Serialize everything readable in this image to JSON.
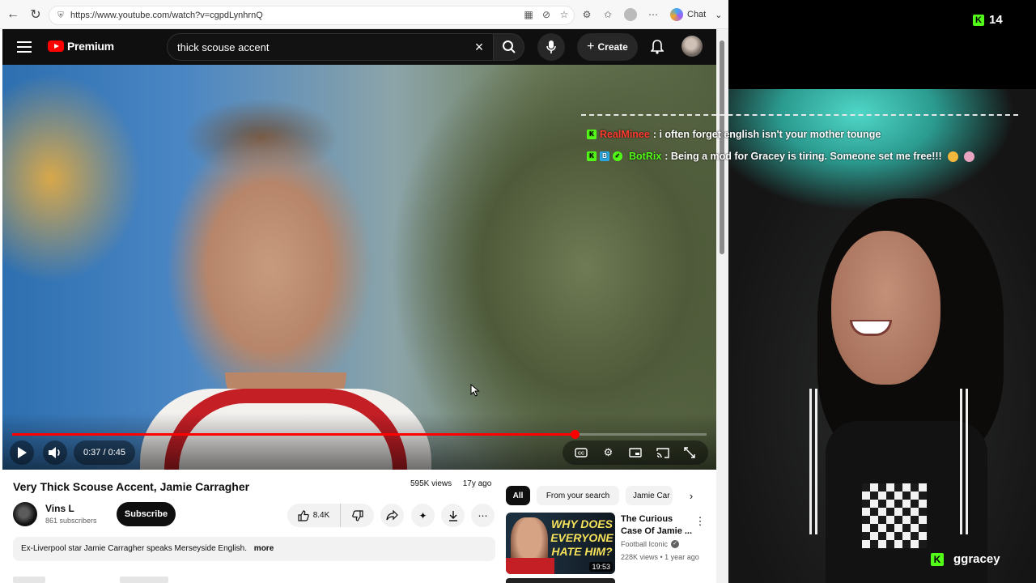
{
  "browser": {
    "url": "https://www.youtube.com/watch?v=cgpdLynhrnQ",
    "chat_label": "Chat"
  },
  "youtube": {
    "logo_text": "Premium",
    "search_query": "thick scouse accent",
    "create_label": "Create"
  },
  "player": {
    "time_label": "0:37 / 0:45",
    "progress": 0.81
  },
  "video": {
    "title": "Very Thick Scouse Accent, Jamie Carragher",
    "views": "595K views",
    "age": "17y ago",
    "channel_name": "Vins L",
    "channel_subs": "861 subscribers",
    "subscribe_label": "Subscribe",
    "likes": "8.4K",
    "description": "Ex-Liverpool star Jamie Carragher speaks Merseyside English.",
    "more_label": "more"
  },
  "related": {
    "chips": [
      "All",
      "From your search",
      "Jamie Car"
    ],
    "item": {
      "thumb_text": "WHY DOES EVERYONE HATE HIM?",
      "duration": "19:53",
      "title": "The Curious Case Of Jamie ...",
      "channel": "Football Iconic",
      "meta": "228K views • 1 year ago"
    }
  },
  "stream": {
    "viewer_count": "14",
    "chat": [
      {
        "user": "RealMinee",
        "text": ": i often forget english isn't your mother tounge"
      },
      {
        "user": "BotRix",
        "text": ": Being a mod for Gracey is tiring. Someone set me free!!!"
      }
    ],
    "streamer": "ggracey"
  },
  "colors": {
    "youtube_red": "#ff0000",
    "kick_green": "#53fc18",
    "yt_dark": "#0f0f0f"
  }
}
